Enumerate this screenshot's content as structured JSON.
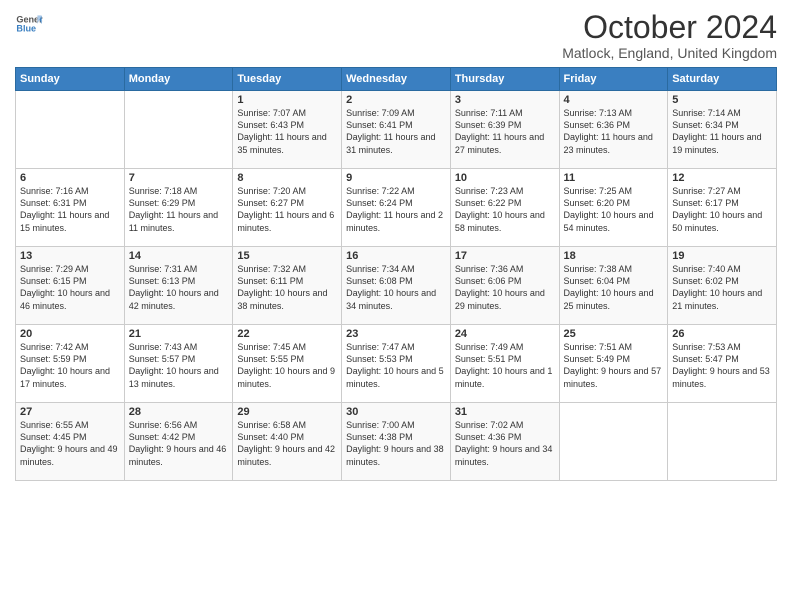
{
  "header": {
    "logo_line1": "General",
    "logo_line2": "Blue",
    "month": "October 2024",
    "location": "Matlock, England, United Kingdom"
  },
  "days_of_week": [
    "Sunday",
    "Monday",
    "Tuesday",
    "Wednesday",
    "Thursday",
    "Friday",
    "Saturday"
  ],
  "weeks": [
    [
      {
        "day": "",
        "info": ""
      },
      {
        "day": "",
        "info": ""
      },
      {
        "day": "1",
        "info": "Sunrise: 7:07 AM\nSunset: 6:43 PM\nDaylight: 11 hours and 35 minutes."
      },
      {
        "day": "2",
        "info": "Sunrise: 7:09 AM\nSunset: 6:41 PM\nDaylight: 11 hours and 31 minutes."
      },
      {
        "day": "3",
        "info": "Sunrise: 7:11 AM\nSunset: 6:39 PM\nDaylight: 11 hours and 27 minutes."
      },
      {
        "day": "4",
        "info": "Sunrise: 7:13 AM\nSunset: 6:36 PM\nDaylight: 11 hours and 23 minutes."
      },
      {
        "day": "5",
        "info": "Sunrise: 7:14 AM\nSunset: 6:34 PM\nDaylight: 11 hours and 19 minutes."
      }
    ],
    [
      {
        "day": "6",
        "info": "Sunrise: 7:16 AM\nSunset: 6:31 PM\nDaylight: 11 hours and 15 minutes."
      },
      {
        "day": "7",
        "info": "Sunrise: 7:18 AM\nSunset: 6:29 PM\nDaylight: 11 hours and 11 minutes."
      },
      {
        "day": "8",
        "info": "Sunrise: 7:20 AM\nSunset: 6:27 PM\nDaylight: 11 hours and 6 minutes."
      },
      {
        "day": "9",
        "info": "Sunrise: 7:22 AM\nSunset: 6:24 PM\nDaylight: 11 hours and 2 minutes."
      },
      {
        "day": "10",
        "info": "Sunrise: 7:23 AM\nSunset: 6:22 PM\nDaylight: 10 hours and 58 minutes."
      },
      {
        "day": "11",
        "info": "Sunrise: 7:25 AM\nSunset: 6:20 PM\nDaylight: 10 hours and 54 minutes."
      },
      {
        "day": "12",
        "info": "Sunrise: 7:27 AM\nSunset: 6:17 PM\nDaylight: 10 hours and 50 minutes."
      }
    ],
    [
      {
        "day": "13",
        "info": "Sunrise: 7:29 AM\nSunset: 6:15 PM\nDaylight: 10 hours and 46 minutes."
      },
      {
        "day": "14",
        "info": "Sunrise: 7:31 AM\nSunset: 6:13 PM\nDaylight: 10 hours and 42 minutes."
      },
      {
        "day": "15",
        "info": "Sunrise: 7:32 AM\nSunset: 6:11 PM\nDaylight: 10 hours and 38 minutes."
      },
      {
        "day": "16",
        "info": "Sunrise: 7:34 AM\nSunset: 6:08 PM\nDaylight: 10 hours and 34 minutes."
      },
      {
        "day": "17",
        "info": "Sunrise: 7:36 AM\nSunset: 6:06 PM\nDaylight: 10 hours and 29 minutes."
      },
      {
        "day": "18",
        "info": "Sunrise: 7:38 AM\nSunset: 6:04 PM\nDaylight: 10 hours and 25 minutes."
      },
      {
        "day": "19",
        "info": "Sunrise: 7:40 AM\nSunset: 6:02 PM\nDaylight: 10 hours and 21 minutes."
      }
    ],
    [
      {
        "day": "20",
        "info": "Sunrise: 7:42 AM\nSunset: 5:59 PM\nDaylight: 10 hours and 17 minutes."
      },
      {
        "day": "21",
        "info": "Sunrise: 7:43 AM\nSunset: 5:57 PM\nDaylight: 10 hours and 13 minutes."
      },
      {
        "day": "22",
        "info": "Sunrise: 7:45 AM\nSunset: 5:55 PM\nDaylight: 10 hours and 9 minutes."
      },
      {
        "day": "23",
        "info": "Sunrise: 7:47 AM\nSunset: 5:53 PM\nDaylight: 10 hours and 5 minutes."
      },
      {
        "day": "24",
        "info": "Sunrise: 7:49 AM\nSunset: 5:51 PM\nDaylight: 10 hours and 1 minute."
      },
      {
        "day": "25",
        "info": "Sunrise: 7:51 AM\nSunset: 5:49 PM\nDaylight: 9 hours and 57 minutes."
      },
      {
        "day": "26",
        "info": "Sunrise: 7:53 AM\nSunset: 5:47 PM\nDaylight: 9 hours and 53 minutes."
      }
    ],
    [
      {
        "day": "27",
        "info": "Sunrise: 6:55 AM\nSunset: 4:45 PM\nDaylight: 9 hours and 49 minutes."
      },
      {
        "day": "28",
        "info": "Sunrise: 6:56 AM\nSunset: 4:42 PM\nDaylight: 9 hours and 46 minutes."
      },
      {
        "day": "29",
        "info": "Sunrise: 6:58 AM\nSunset: 4:40 PM\nDaylight: 9 hours and 42 minutes."
      },
      {
        "day": "30",
        "info": "Sunrise: 7:00 AM\nSunset: 4:38 PM\nDaylight: 9 hours and 38 minutes."
      },
      {
        "day": "31",
        "info": "Sunrise: 7:02 AM\nSunset: 4:36 PM\nDaylight: 9 hours and 34 minutes."
      },
      {
        "day": "",
        "info": ""
      },
      {
        "day": "",
        "info": ""
      }
    ]
  ]
}
